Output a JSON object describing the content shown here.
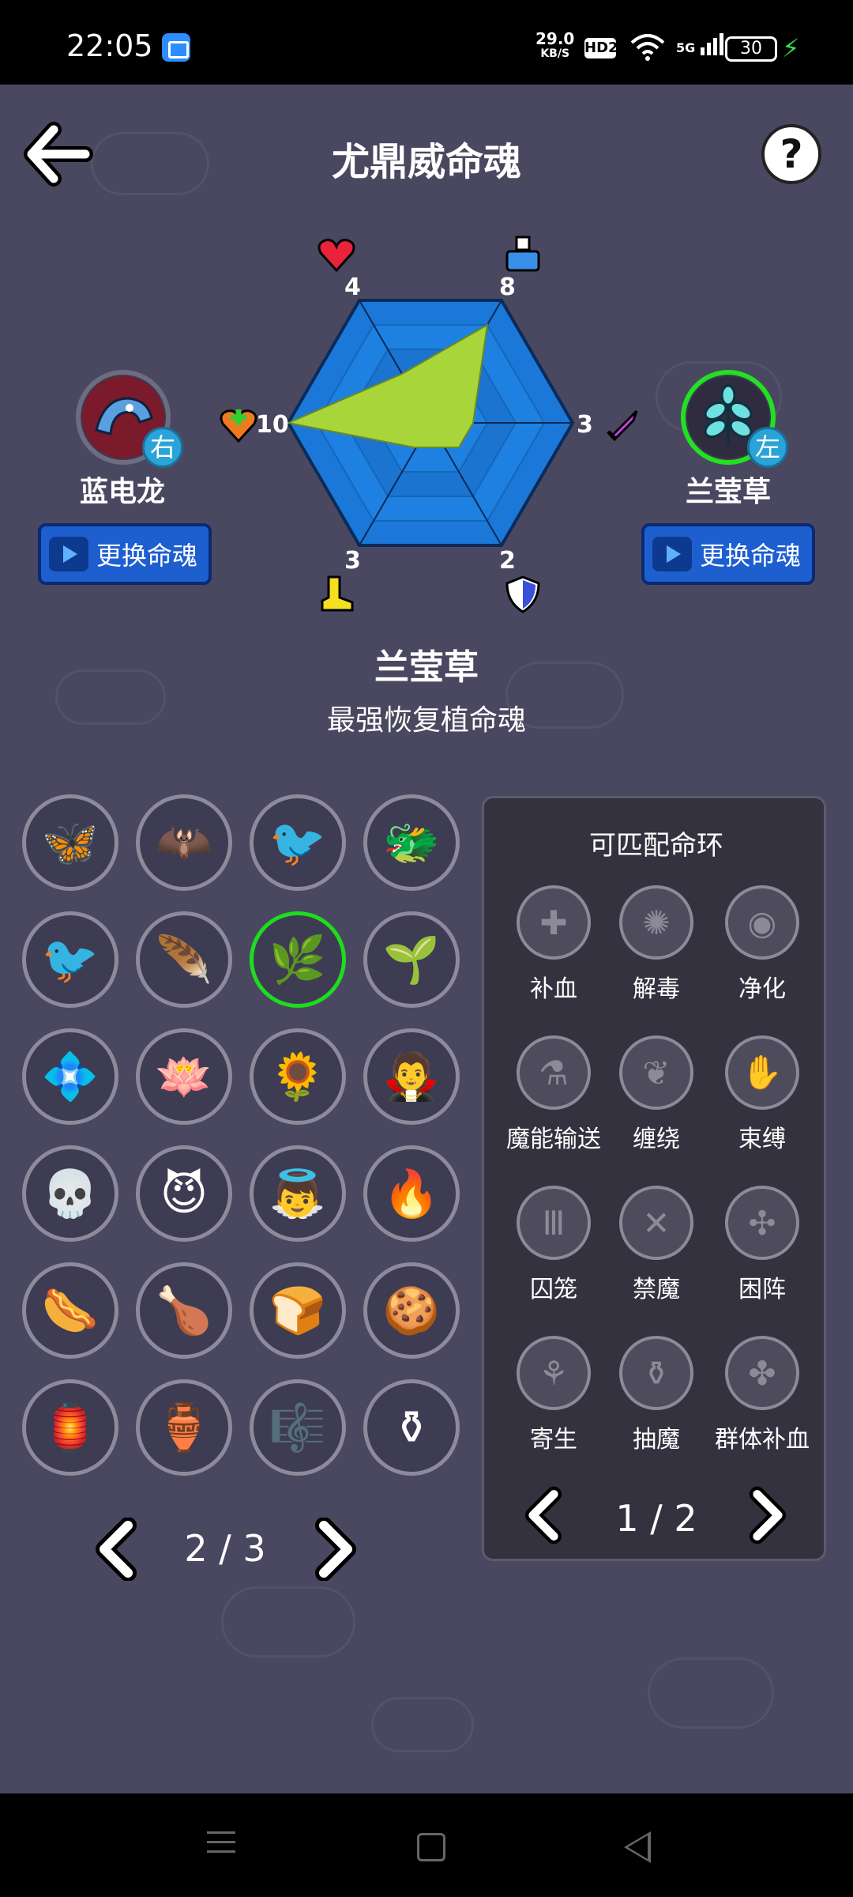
{
  "status_bar": {
    "time": "22:05",
    "net_speed": "29.0",
    "net_unit": "KB/S",
    "hd": "HD2",
    "signal": "5G",
    "battery": "30"
  },
  "header": {
    "title": "尤鼎威命魂",
    "help": "?"
  },
  "left_slot": {
    "name": "蓝电龙",
    "badge": "右",
    "button": "更换命魂",
    "icon": "blue-dragon-icon"
  },
  "right_slot": {
    "name": "兰莹草",
    "badge": "左",
    "button": "更换命魂",
    "icon": "leaf-icon"
  },
  "stats": {
    "top_left": "4",
    "top_right": "8",
    "right": "3",
    "bottom_right": "2",
    "bottom_left": "3",
    "left": "10"
  },
  "selected": {
    "name": "兰莹草",
    "description": "最强恢复植命魂"
  },
  "soul_grid": {
    "items": [
      {
        "icon": "butterfly-icon",
        "glyph": "🦋"
      },
      {
        "icon": "bat-icon",
        "glyph": "🦇"
      },
      {
        "icon": "phoenix-icon",
        "glyph": "🐦"
      },
      {
        "icon": "fire-dragon-icon",
        "glyph": "🐲"
      },
      {
        "icon": "swallow-icon",
        "glyph": "🐦"
      },
      {
        "icon": "fire-feather-icon",
        "glyph": "🪶"
      },
      {
        "icon": "blue-leaf-icon",
        "glyph": "🌿"
      },
      {
        "icon": "vine-icon",
        "glyph": "🌱"
      },
      {
        "icon": "blue-flower-icon",
        "glyph": "💠"
      },
      {
        "icon": "lotus-icon",
        "glyph": "🪷"
      },
      {
        "icon": "sunflower-icon",
        "glyph": "🌻"
      },
      {
        "icon": "vampire-icon",
        "glyph": "🧛"
      },
      {
        "icon": "skull-icon",
        "glyph": "💀"
      },
      {
        "icon": "demon-icon",
        "glyph": "😈"
      },
      {
        "icon": "angel-icon",
        "glyph": "👼"
      },
      {
        "icon": "fire-warrior-icon",
        "glyph": "🔥"
      },
      {
        "icon": "sausage-icon",
        "glyph": "🌭"
      },
      {
        "icon": "drumstick-icon",
        "glyph": "🍗"
      },
      {
        "icon": "bread-icon",
        "glyph": "🍞"
      },
      {
        "icon": "cookie-icon",
        "glyph": "🍪"
      },
      {
        "icon": "red-crystal-icon",
        "glyph": "🏮"
      },
      {
        "icon": "green-cauldron-icon",
        "glyph": "🏺"
      },
      {
        "icon": "lyre-icon",
        "glyph": "🎼"
      },
      {
        "icon": "golden-urn-icon",
        "glyph": "⚱"
      }
    ],
    "page": "2 / 3"
  },
  "ring_panel": {
    "title": "可匹配命环",
    "items": [
      {
        "label": "补血",
        "icon": "heal-icon",
        "glyph": "✚"
      },
      {
        "label": "解毒",
        "icon": "detox-icon",
        "glyph": "✺"
      },
      {
        "label": "净化",
        "icon": "purify-icon",
        "glyph": "◉"
      },
      {
        "label": "魔能输送",
        "icon": "mana-transfer-icon",
        "glyph": "⚗"
      },
      {
        "label": "缠绕",
        "icon": "entangle-icon",
        "glyph": "❦"
      },
      {
        "label": "束缚",
        "icon": "bind-icon",
        "glyph": "✋"
      },
      {
        "label": "囚笼",
        "icon": "cage-icon",
        "glyph": "Ⅲ"
      },
      {
        "label": "禁魔",
        "icon": "silence-icon",
        "glyph": "✕"
      },
      {
        "label": "困阵",
        "icon": "trap-icon",
        "glyph": "✣"
      },
      {
        "label": "寄生",
        "icon": "parasite-icon",
        "glyph": "⚘"
      },
      {
        "label": "抽魔",
        "icon": "drain-icon",
        "glyph": "⚱"
      },
      {
        "label": "群体补血",
        "icon": "group-heal-icon",
        "glyph": "✤"
      }
    ],
    "page": "1 / 2"
  },
  "colors": {
    "background": "#4a4860",
    "radar_fill": "#1b78d8",
    "radar_value": "#a8d63a",
    "selected_ring": "#1edc1e",
    "button": "#1e5fd0"
  }
}
